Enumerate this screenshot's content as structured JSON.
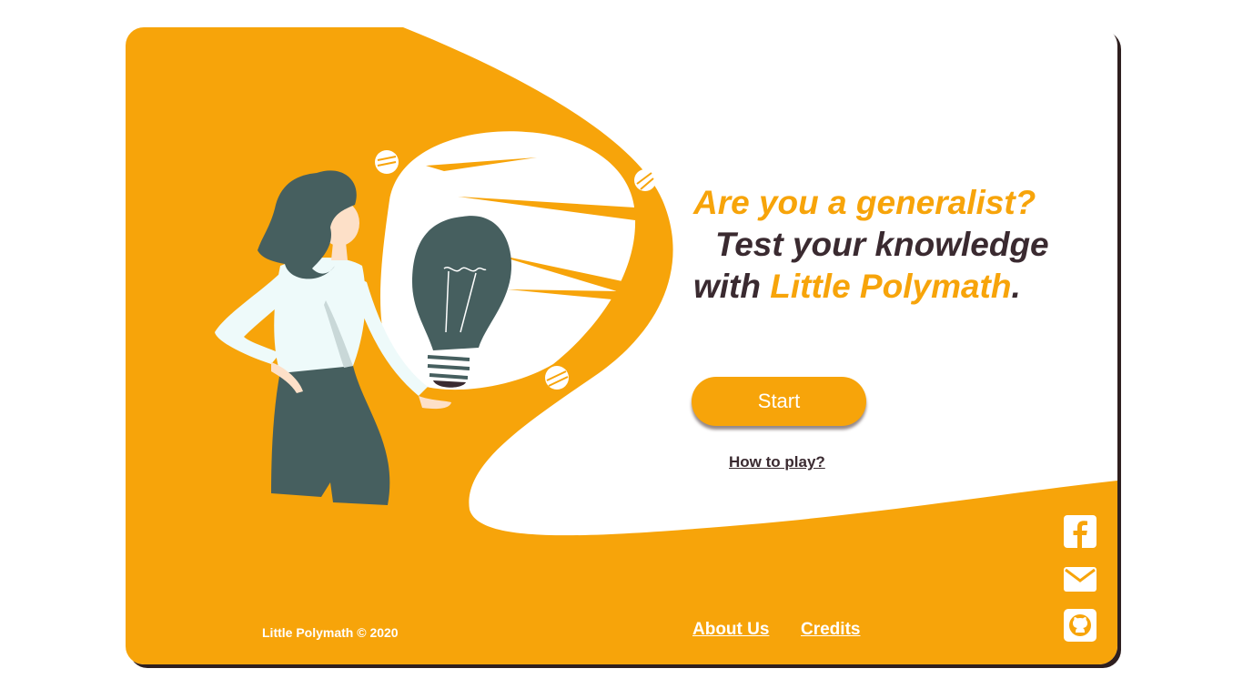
{
  "hero": {
    "line1": "Are you a generalist?",
    "line2": "Test your knowledge",
    "line3_prefix": "with ",
    "line3_brand": "Little Polymath",
    "line3_suffix": "."
  },
  "actions": {
    "start_label": "Start",
    "how_to_play_label": "How to play?"
  },
  "footer": {
    "copyright": "Little Polymath © 2020",
    "about_label": "About Us",
    "credits_label": "Credits"
  },
  "social": [
    {
      "icon": "facebook-icon"
    },
    {
      "icon": "email-icon"
    },
    {
      "icon": "github-icon"
    }
  ],
  "colors": {
    "accent": "#f7a40a",
    "text_dark": "#3a2a30",
    "figure_dark": "#465f5f",
    "shirt": "#eefafa",
    "shadow": "#2e1f1f"
  }
}
